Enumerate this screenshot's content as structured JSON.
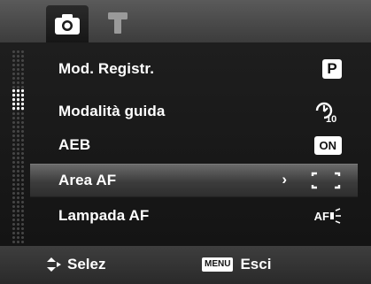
{
  "header": {
    "tabs": [
      {
        "icon": "camera-icon",
        "active": true
      },
      {
        "icon": "wrench-icon",
        "active": false
      }
    ]
  },
  "menu": {
    "items": [
      {
        "label": "Mod. Registr.",
        "value_icon": "program-mode-p-icon",
        "value_text": "P"
      },
      {
        "label": "Modalità guida",
        "value_icon": "self-timer-10s-icon",
        "value_text": "10"
      },
      {
        "label": "AEB",
        "value_icon": "on-badge-icon",
        "value_text": "ON"
      },
      {
        "label": "Area AF",
        "value_icon": "af-area-bracket-icon",
        "value_text": "",
        "selected": true
      },
      {
        "label": "Lampada AF",
        "value_icon": "af-lamp-icon",
        "value_text": "AF"
      }
    ],
    "selected_arrow": "›"
  },
  "footer": {
    "nav_label": "Selez",
    "menu_key": "MENU",
    "menu_label": "Esci"
  },
  "colors": {
    "background": "#121212",
    "header": "#4a4a4a",
    "selected_row": "#555555",
    "text": "#ffffff"
  }
}
